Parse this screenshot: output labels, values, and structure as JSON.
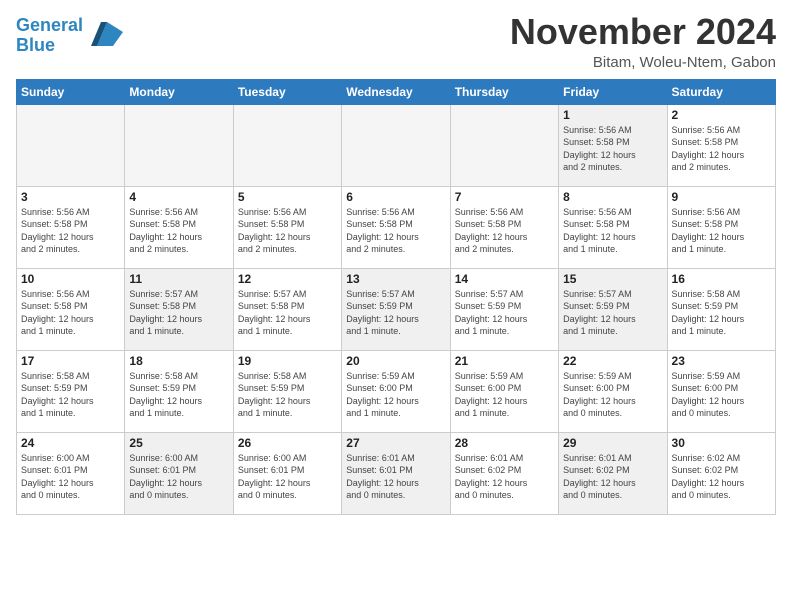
{
  "header": {
    "logo_line1": "General",
    "logo_line2": "Blue",
    "month": "November 2024",
    "location": "Bitam, Woleu-Ntem, Gabon"
  },
  "days_of_week": [
    "Sunday",
    "Monday",
    "Tuesday",
    "Wednesday",
    "Thursday",
    "Friday",
    "Saturday"
  ],
  "weeks": [
    [
      {
        "day": "",
        "info": "",
        "empty": true
      },
      {
        "day": "",
        "info": "",
        "empty": true
      },
      {
        "day": "",
        "info": "",
        "empty": true
      },
      {
        "day": "",
        "info": "",
        "empty": true
      },
      {
        "day": "",
        "info": "",
        "empty": true
      },
      {
        "day": "1",
        "info": "Sunrise: 5:56 AM\nSunset: 5:58 PM\nDaylight: 12 hours\nand 2 minutes."
      },
      {
        "day": "2",
        "info": "Sunrise: 5:56 AM\nSunset: 5:58 PM\nDaylight: 12 hours\nand 2 minutes."
      }
    ],
    [
      {
        "day": "3",
        "info": "Sunrise: 5:56 AM\nSunset: 5:58 PM\nDaylight: 12 hours\nand 2 minutes."
      },
      {
        "day": "4",
        "info": "Sunrise: 5:56 AM\nSunset: 5:58 PM\nDaylight: 12 hours\nand 2 minutes."
      },
      {
        "day": "5",
        "info": "Sunrise: 5:56 AM\nSunset: 5:58 PM\nDaylight: 12 hours\nand 2 minutes."
      },
      {
        "day": "6",
        "info": "Sunrise: 5:56 AM\nSunset: 5:58 PM\nDaylight: 12 hours\nand 2 minutes."
      },
      {
        "day": "7",
        "info": "Sunrise: 5:56 AM\nSunset: 5:58 PM\nDaylight: 12 hours\nand 2 minutes."
      },
      {
        "day": "8",
        "info": "Sunrise: 5:56 AM\nSunset: 5:58 PM\nDaylight: 12 hours\nand 1 minute."
      },
      {
        "day": "9",
        "info": "Sunrise: 5:56 AM\nSunset: 5:58 PM\nDaylight: 12 hours\nand 1 minute."
      }
    ],
    [
      {
        "day": "10",
        "info": "Sunrise: 5:56 AM\nSunset: 5:58 PM\nDaylight: 12 hours\nand 1 minute."
      },
      {
        "day": "11",
        "info": "Sunrise: 5:57 AM\nSunset: 5:58 PM\nDaylight: 12 hours\nand 1 minute."
      },
      {
        "day": "12",
        "info": "Sunrise: 5:57 AM\nSunset: 5:58 PM\nDaylight: 12 hours\nand 1 minute."
      },
      {
        "day": "13",
        "info": "Sunrise: 5:57 AM\nSunset: 5:59 PM\nDaylight: 12 hours\nand 1 minute."
      },
      {
        "day": "14",
        "info": "Sunrise: 5:57 AM\nSunset: 5:59 PM\nDaylight: 12 hours\nand 1 minute."
      },
      {
        "day": "15",
        "info": "Sunrise: 5:57 AM\nSunset: 5:59 PM\nDaylight: 12 hours\nand 1 minute."
      },
      {
        "day": "16",
        "info": "Sunrise: 5:58 AM\nSunset: 5:59 PM\nDaylight: 12 hours\nand 1 minute."
      }
    ],
    [
      {
        "day": "17",
        "info": "Sunrise: 5:58 AM\nSunset: 5:59 PM\nDaylight: 12 hours\nand 1 minute."
      },
      {
        "day": "18",
        "info": "Sunrise: 5:58 AM\nSunset: 5:59 PM\nDaylight: 12 hours\nand 1 minute."
      },
      {
        "day": "19",
        "info": "Sunrise: 5:58 AM\nSunset: 5:59 PM\nDaylight: 12 hours\nand 1 minute."
      },
      {
        "day": "20",
        "info": "Sunrise: 5:59 AM\nSunset: 6:00 PM\nDaylight: 12 hours\nand 1 minute."
      },
      {
        "day": "21",
        "info": "Sunrise: 5:59 AM\nSunset: 6:00 PM\nDaylight: 12 hours\nand 1 minute."
      },
      {
        "day": "22",
        "info": "Sunrise: 5:59 AM\nSunset: 6:00 PM\nDaylight: 12 hours\nand 0 minutes."
      },
      {
        "day": "23",
        "info": "Sunrise: 5:59 AM\nSunset: 6:00 PM\nDaylight: 12 hours\nand 0 minutes."
      }
    ],
    [
      {
        "day": "24",
        "info": "Sunrise: 6:00 AM\nSunset: 6:01 PM\nDaylight: 12 hours\nand 0 minutes."
      },
      {
        "day": "25",
        "info": "Sunrise: 6:00 AM\nSunset: 6:01 PM\nDaylight: 12 hours\nand 0 minutes."
      },
      {
        "day": "26",
        "info": "Sunrise: 6:00 AM\nSunset: 6:01 PM\nDaylight: 12 hours\nand 0 minutes."
      },
      {
        "day": "27",
        "info": "Sunrise: 6:01 AM\nSunset: 6:01 PM\nDaylight: 12 hours\nand 0 minutes."
      },
      {
        "day": "28",
        "info": "Sunrise: 6:01 AM\nSunset: 6:02 PM\nDaylight: 12 hours\nand 0 minutes."
      },
      {
        "day": "29",
        "info": "Sunrise: 6:01 AM\nSunset: 6:02 PM\nDaylight: 12 hours\nand 0 minutes."
      },
      {
        "day": "30",
        "info": "Sunrise: 6:02 AM\nSunset: 6:02 PM\nDaylight: 12 hours\nand 0 minutes."
      }
    ]
  ]
}
